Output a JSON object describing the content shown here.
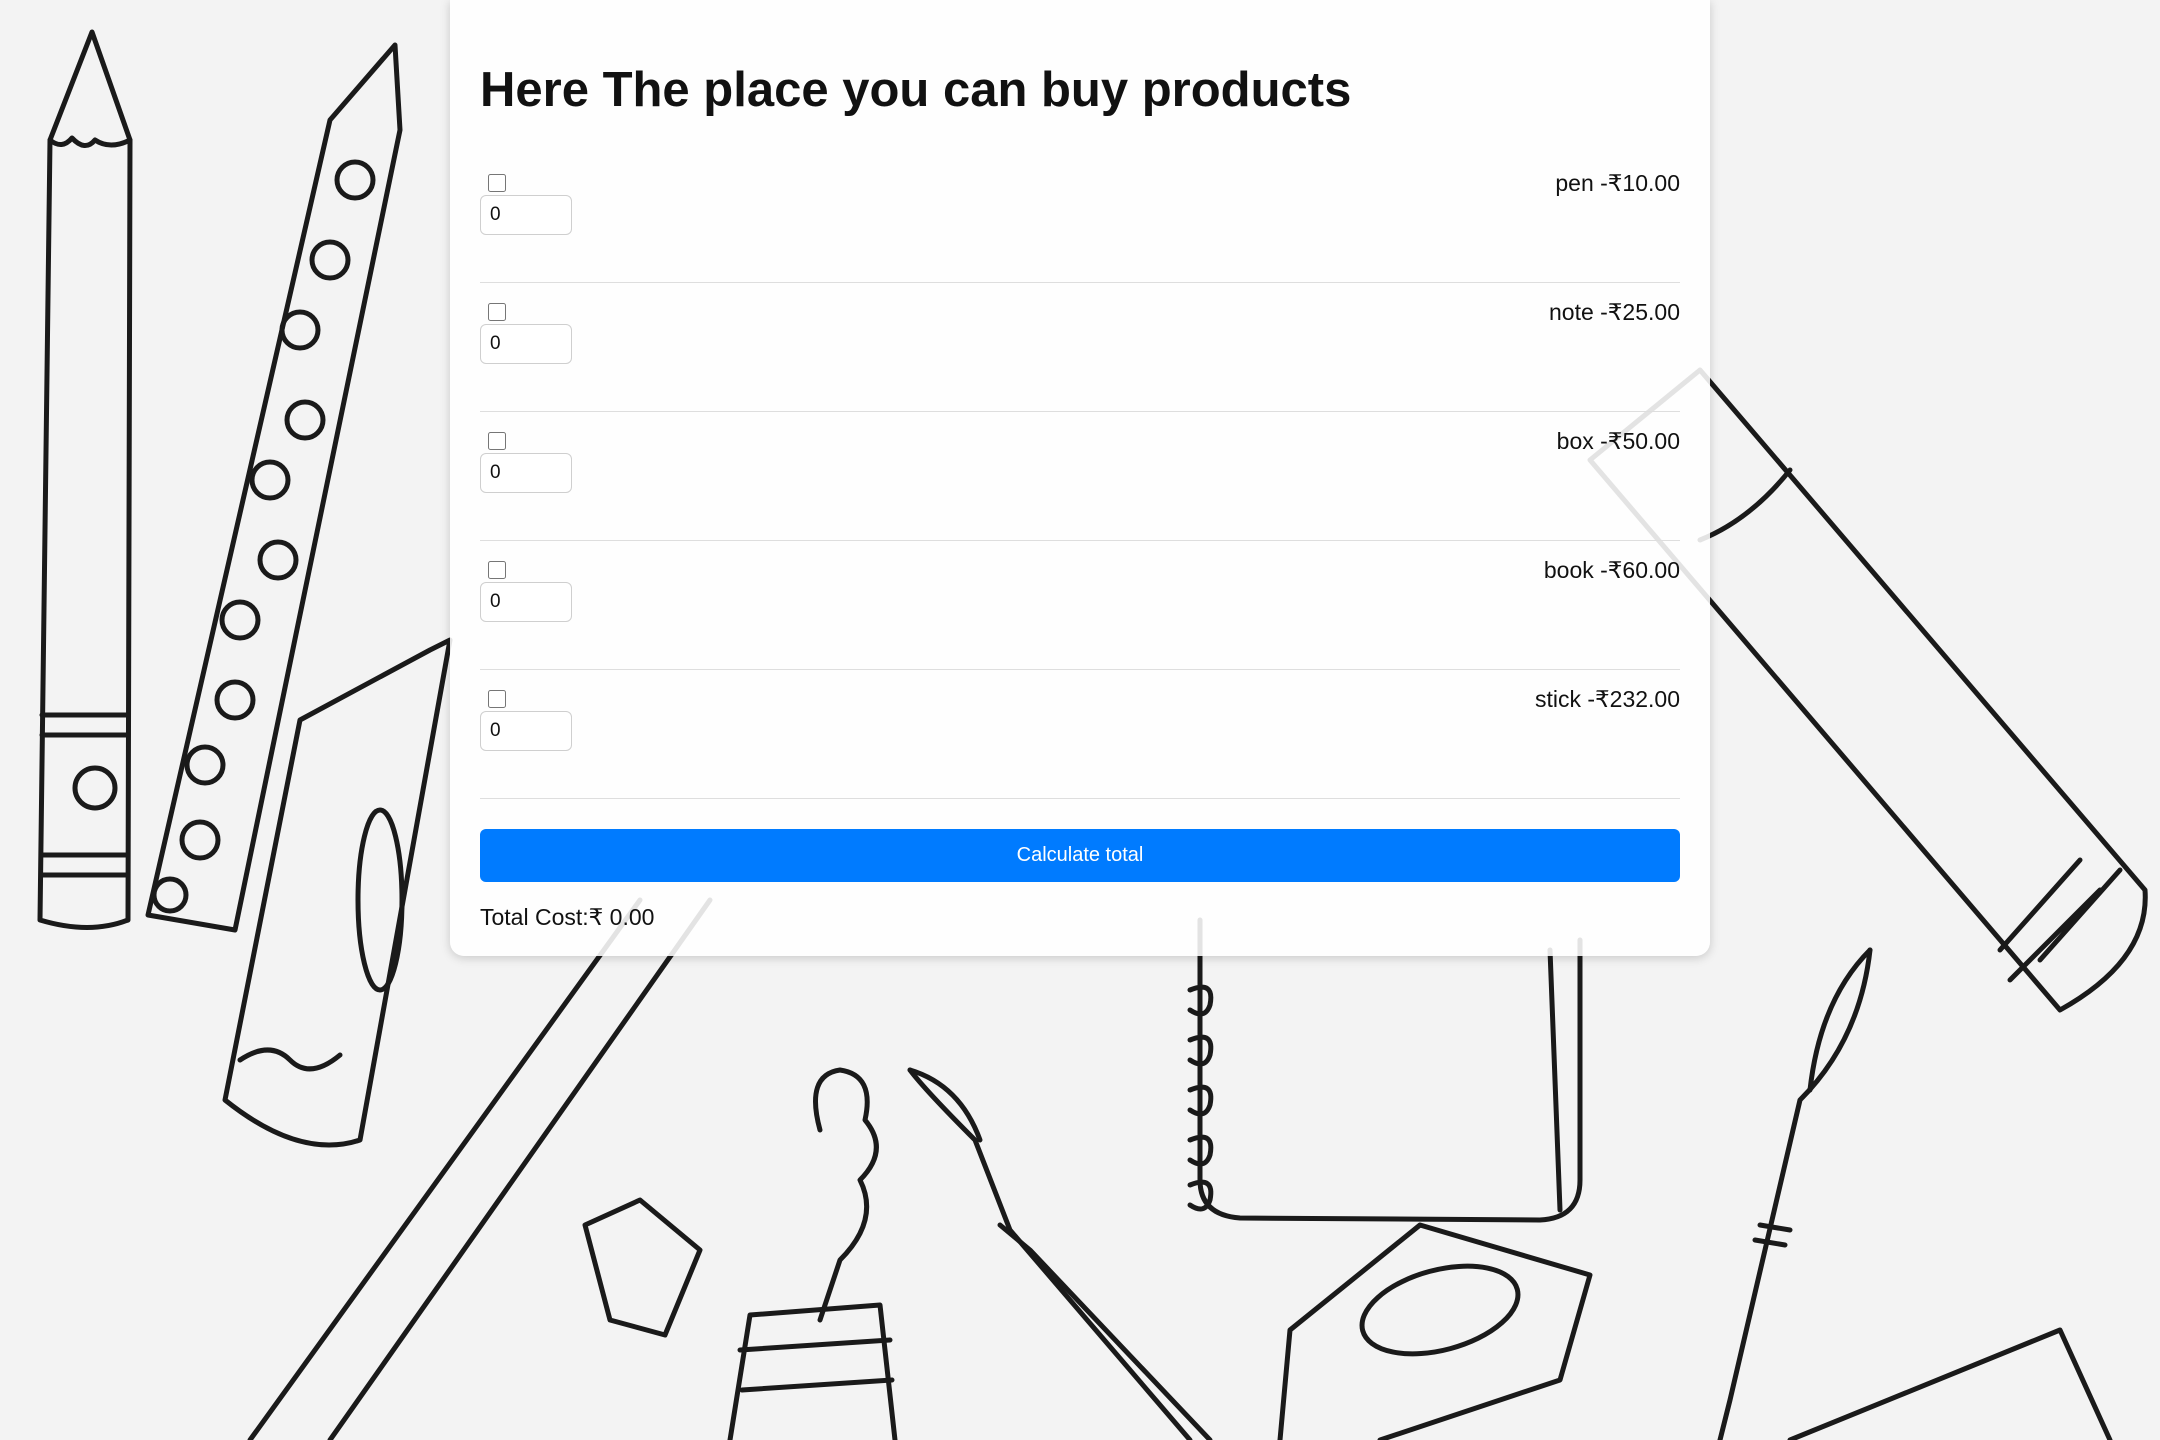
{
  "page": {
    "title": "Here The place you can buy products"
  },
  "products": [
    {
      "name": "pen",
      "price_label": "pen -₹10.00",
      "quantity": "0",
      "checked": false
    },
    {
      "name": "note",
      "price_label": "note -₹25.00",
      "quantity": "0",
      "checked": false
    },
    {
      "name": "box",
      "price_label": "box -₹50.00",
      "quantity": "0",
      "checked": false
    },
    {
      "name": "book",
      "price_label": "book -₹60.00",
      "quantity": "0",
      "checked": false
    },
    {
      "name": "stick",
      "price_label": "stick -₹232.00",
      "quantity": "0",
      "checked": false
    }
  ],
  "actions": {
    "calculate_label": "Calculate total"
  },
  "summary": {
    "total_label": "Total Cost:₹ 0.00"
  },
  "colors": {
    "accent": "#007bff",
    "background": "#f3f3f3",
    "card": "#ffffff"
  }
}
